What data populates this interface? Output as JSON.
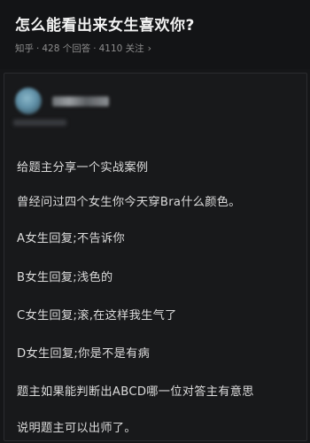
{
  "question": {
    "title": "怎么能看出来女生喜欢你?",
    "source": "知乎",
    "answers": "428 个回答",
    "followers": "4110 关注",
    "chevron": "›"
  },
  "answer": {
    "author_icon": "blurred-avatar",
    "lines": [
      "给题主分享一个实战案例",
      "曾经问过四个女生你今天穿Bra什么颜色。",
      "A女生回复;不告诉你",
      "B女生回复;浅色的",
      "C女生回复;滚,在这样我生气了",
      "D女生回复;你是不是有病",
      "题主如果能判断出ABCD哪一位对答主有意思",
      "说明题主可以出师了。"
    ]
  }
}
